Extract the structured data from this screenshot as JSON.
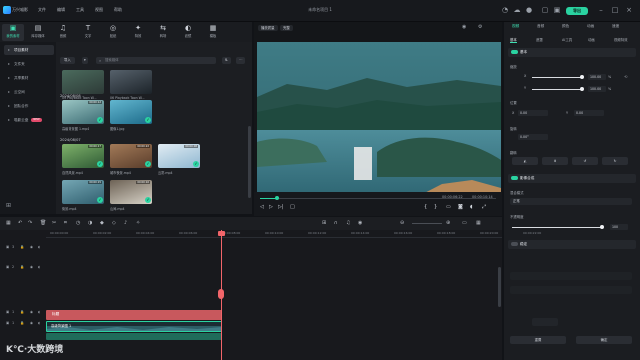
{
  "titlebar": {
    "app_name": "万兴喵影",
    "menu": [
      "文件",
      "编辑",
      "工具",
      "视图",
      "帮助"
    ],
    "project_title": "未命名项目 1",
    "export_label": "导出"
  },
  "toolbar": {
    "items": [
      {
        "icon": "media-icon",
        "glyph": "▣",
        "label": "我的素材",
        "active": true
      },
      {
        "icon": "folder-icon",
        "glyph": "▤",
        "label": "库存媒体"
      },
      {
        "icon": "music-icon",
        "glyph": "♫",
        "label": "音频"
      },
      {
        "icon": "text-icon",
        "glyph": "T",
        "label": "文字"
      },
      {
        "icon": "sticker-icon",
        "glyph": "◎",
        "label": "贴纸"
      },
      {
        "icon": "effects-icon",
        "glyph": "✦",
        "label": "特效"
      },
      {
        "icon": "transition-icon",
        "glyph": "⇆",
        "label": "转场"
      },
      {
        "icon": "filter-icon",
        "glyph": "◐",
        "label": "滤镜"
      },
      {
        "icon": "template-icon",
        "glyph": "▦",
        "label": "模板"
      }
    ]
  },
  "sidebar": {
    "items": [
      {
        "label": "项目素材",
        "active": true
      },
      {
        "label": "文件夹"
      },
      {
        "label": "共享素材"
      },
      {
        "label": "云空间"
      },
      {
        "label": "团队合作"
      },
      {
        "label": "喵影云盘",
        "badge": "NEW"
      }
    ]
  },
  "media": {
    "import_label": "导入",
    "search_placeholder": "搜索媒体",
    "groups": [
      {
        "date": "",
        "items": [
          {
            "label": "09 Playback Toon W...",
            "duration": ""
          },
          {
            "label": "06 Playback Toon W...",
            "duration": ""
          }
        ]
      },
      {
        "date": "2024/08/08",
        "items": [
          {
            "label": "高级背景图 1.mp4",
            "duration": "00:00:12"
          },
          {
            "label": "图像1.jpg",
            "duration": ""
          }
        ]
      },
      {
        "date": "2024/08/07",
        "items": [
          {
            "label": "自然风景.mp4",
            "duration": "00:00:17"
          },
          {
            "label": "城市夜景.mp4",
            "duration": "00:00:22"
          },
          {
            "label": "云雾.mp4",
            "duration": "00:00:08"
          },
          {
            "label": "街景.mp4",
            "duration": "00:00:15"
          },
          {
            "label": "山间.mp4",
            "duration": "00:00:10"
          }
        ]
      }
    ]
  },
  "preview": {
    "quality_label": "播放质量",
    "ratio_label": "完整",
    "current_time": "00:00:06:22",
    "total_time": "00:00:10:14",
    "progress": 0.07
  },
  "properties": {
    "tabs": [
      "视频",
      "音频",
      "颜色",
      "动画",
      "速度"
    ],
    "active_tab": 0,
    "subtabs": [
      "基本",
      "遮罩",
      "AI工具",
      "动画",
      "视频特效"
    ],
    "sections": {
      "basic": "基本",
      "scale": "缩放",
      "scale_x": "X",
      "scale_y": "Y",
      "scale_x_value": "100.00",
      "scale_y_value": "100.00",
      "scale_unit": "%",
      "position": "位置",
      "pos_x_label": "X",
      "pos_x": "0.00",
      "pos_y_label": "Y",
      "pos_y": "0.00",
      "rotate": "旋转",
      "rotate_value": "0.00°",
      "flip": "翻转",
      "compositing": "影像合成",
      "blend_mode": "混合模式",
      "blend_value": "正常",
      "opacity": "不透明度",
      "opacity_value": "100",
      "opacity_level": 1.0,
      "stabilize": "稳定",
      "reset_label": "重置",
      "ok_label": "确定"
    }
  },
  "timeline": {
    "ruler": [
      "00:00:00:00",
      "00:00:02:00",
      "00:00:04:00",
      "00:00:06:00",
      "00:00:08:00",
      "00:00:10:00",
      "00:00:12:00",
      "00:00:14:00",
      "00:00:16:00",
      "00:00:18:00",
      "00:00:20:00",
      "00:00:22:00"
    ],
    "tracks": [
      "3",
      "2",
      "1",
      "1"
    ],
    "title_clip": "标题",
    "video_clip": "高级背景图 1"
  },
  "watermark": "K℃·大数跨境",
  "colors": {
    "accent": "#2ad3a1",
    "playhead": "#f2656a",
    "title_clip": "#c8585d"
  }
}
